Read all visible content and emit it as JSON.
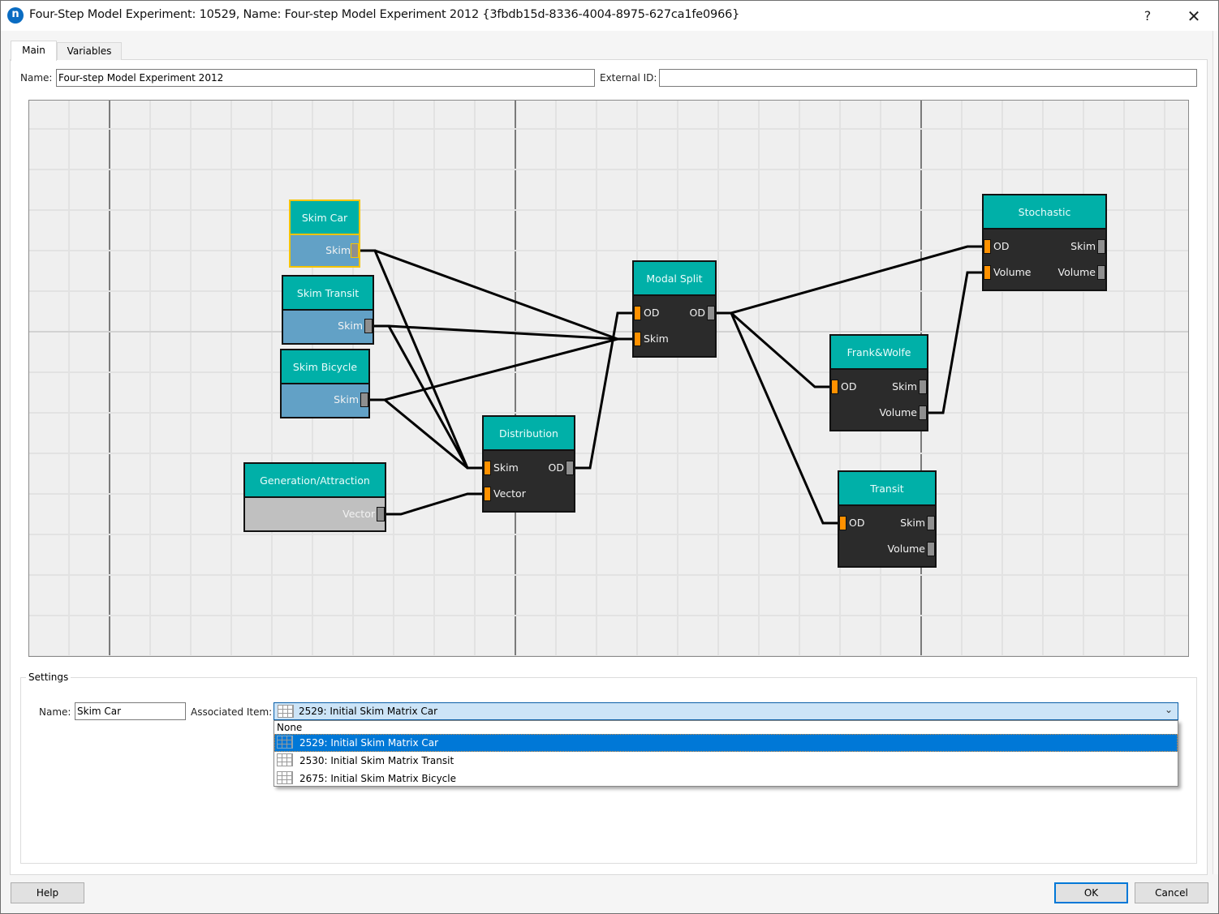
{
  "window": {
    "title": "Four-Step Model Experiment: 10529, Name: Four-step Model Experiment 2012  {3fbdb15d-8336-4004-8975-627ca1fe0966}",
    "app_icon": "n",
    "help_label": "?",
    "close_label": "✕"
  },
  "tabs": [
    {
      "label": "Main",
      "active": true
    },
    {
      "label": "Variables",
      "active": false
    }
  ],
  "main": {
    "name_label": "Name:",
    "name_value": "Four-step Model Experiment 2012",
    "external_id_label": "External ID:",
    "external_id_value": ""
  },
  "graph": {
    "colors": {
      "header": "#00b0a8",
      "body_dark": "#2b2b2b",
      "body_skim": "#62a1c6",
      "body_vector": "#c0c0c0",
      "input_port": "#ff9100",
      "output_port": "#8f8f8f",
      "selected": "#f5c400"
    },
    "nodes": [
      {
        "id": "skim_car",
        "title": "Skim Car",
        "selected": true,
        "inputs": [],
        "outputs": [
          "Skim"
        ]
      },
      {
        "id": "skim_transit",
        "title": "Skim Transit",
        "selected": false,
        "inputs": [],
        "outputs": [
          "Skim"
        ]
      },
      {
        "id": "skim_bicycle",
        "title": "Skim Bicycle",
        "selected": false,
        "inputs": [],
        "outputs": [
          "Skim"
        ]
      },
      {
        "id": "generation",
        "title": "Generation/Attraction",
        "selected": false,
        "inputs": [],
        "outputs": [
          "Vector"
        ]
      },
      {
        "id": "distribution",
        "title": "Distribution",
        "selected": false,
        "inputs": [
          "Skim",
          "Vector"
        ],
        "outputs": [
          "OD"
        ]
      },
      {
        "id": "modal_split",
        "title": "Modal Split",
        "selected": false,
        "inputs": [
          "OD",
          "Skim"
        ],
        "outputs": [
          "OD"
        ]
      },
      {
        "id": "stochastic",
        "title": "Stochastic",
        "selected": false,
        "inputs": [
          "OD",
          "Volume"
        ],
        "outputs": [
          "Skim",
          "Volume"
        ]
      },
      {
        "id": "frank_wolfe",
        "title": "Frank&Wolfe",
        "selected": false,
        "inputs": [
          "OD"
        ],
        "outputs": [
          "Skim",
          "Volume"
        ]
      },
      {
        "id": "transit",
        "title": "Transit",
        "selected": false,
        "inputs": [
          "OD"
        ],
        "outputs": [
          "Skim",
          "Volume"
        ]
      }
    ],
    "edges": [
      {
        "from": "skim_car.Skim",
        "to": "distribution.Skim"
      },
      {
        "from": "skim_car.Skim",
        "to": "modal_split.Skim"
      },
      {
        "from": "skim_transit.Skim",
        "to": "distribution.Skim"
      },
      {
        "from": "skim_transit.Skim",
        "to": "modal_split.Skim"
      },
      {
        "from": "skim_bicycle.Skim",
        "to": "distribution.Skim"
      },
      {
        "from": "skim_bicycle.Skim",
        "to": "modal_split.Skim"
      },
      {
        "from": "generation.Vector",
        "to": "distribution.Vector"
      },
      {
        "from": "distribution.OD",
        "to": "modal_split.OD"
      },
      {
        "from": "modal_split.OD",
        "to": "stochastic.OD"
      },
      {
        "from": "modal_split.OD",
        "to": "frank_wolfe.OD"
      },
      {
        "from": "modal_split.OD",
        "to": "transit.OD"
      },
      {
        "from": "frank_wolfe.Volume",
        "to": "stochastic.Volume"
      }
    ]
  },
  "settings": {
    "title": "Settings",
    "name_label": "Name:",
    "name_value": "Skim Car",
    "assoc_label": "Associated Item:",
    "assoc_value": "2529: Initial Skim Matrix Car",
    "assoc_icon": "matrix-grid-icon",
    "dropdown_open": true,
    "options": [
      {
        "label": "None",
        "icon": null,
        "selected": false
      },
      {
        "label": "2529: Initial Skim Matrix Car",
        "icon": "matrix-grid-icon",
        "selected": true
      },
      {
        "label": "2530: Initial Skim Matrix Transit",
        "icon": "matrix-grid-icon",
        "selected": false
      },
      {
        "label": "2675: Initial Skim Matrix Bicycle",
        "icon": "matrix-grid-icon",
        "selected": false
      }
    ]
  },
  "footer": {
    "help_label": "Help",
    "ok_label": "OK",
    "cancel_label": "Cancel"
  }
}
